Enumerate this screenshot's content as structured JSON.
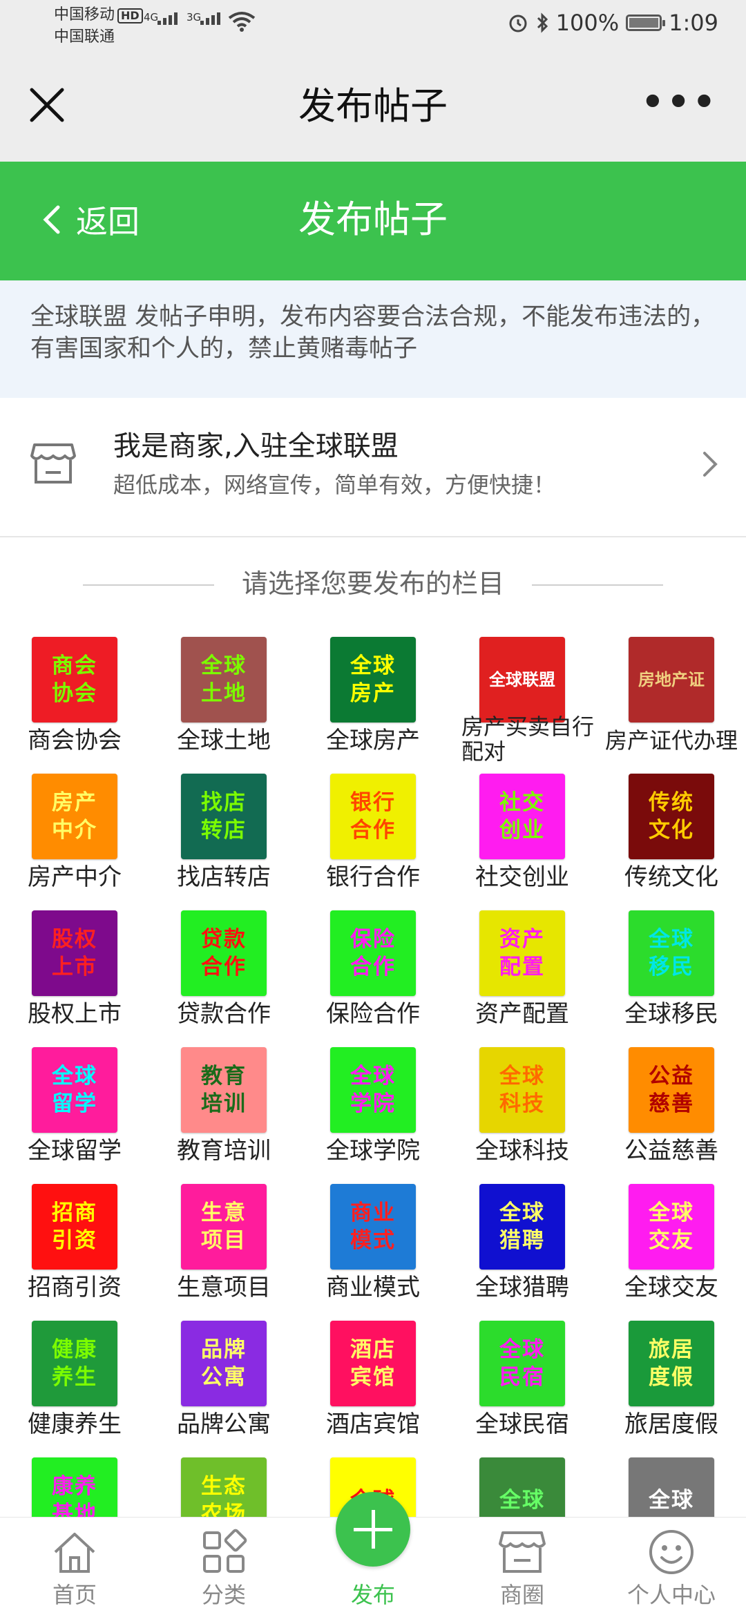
{
  "status_bar": {
    "carrier1": "中国移动",
    "hd": "HD",
    "carrier2": "中国联通",
    "net1": "4G",
    "net2": "3G",
    "battery": "100%",
    "time": "1:09"
  },
  "wx_bar": {
    "title": "发布帖子"
  },
  "header": {
    "back_label": "返回",
    "title": "发布帖子",
    "accent": "#3cc24e"
  },
  "notice": {
    "text": "全球联盟 发帖子申明，发布内容要合法合规，不能发布违法的，有害国家和个人的，禁止黄赌毒帖子"
  },
  "merchant": {
    "title": "我是商家,入驻全球联盟",
    "subtitle": "超低成本，网络宣传，简单有效，方便快捷！"
  },
  "section": {
    "title": "请选择您要发布的栏目"
  },
  "categories": [
    {
      "label": "商会协会",
      "tile1": "商会",
      "tile2": "协会",
      "bg": "#ee1c25",
      "fg": "#7cfc00"
    },
    {
      "label": "全球土地",
      "tile1": "全球",
      "tile2": "土地",
      "bg": "#a0524e",
      "fg": "#7cfc00"
    },
    {
      "label": "全球房产",
      "tile1": "全球",
      "tile2": "房产",
      "bg": "#0b7a33",
      "fg": "#ffff00"
    },
    {
      "label": "房产买卖自行配对",
      "tile1": "全球联盟",
      "tile2": "",
      "bg": "#e02020",
      "fg": "#ffffff"
    },
    {
      "label": "房产证代办理",
      "tile1": "房地产证",
      "tile2": "",
      "bg": "#b02a2a",
      "fg": "#f0d080"
    },
    {
      "label": "房产中介",
      "tile1": "房产",
      "tile2": "中介",
      "bg": "#ff8c00",
      "fg": "#ffff66"
    },
    {
      "label": "找店转店",
      "tile1": "找店",
      "tile2": "转店",
      "bg": "#126b52",
      "fg": "#7cfc00"
    },
    {
      "label": "银行合作",
      "tile1": "银行",
      "tile2": "合作",
      "bg": "#f0f000",
      "fg": "#ff4500"
    },
    {
      "label": "社交创业",
      "tile1": "社交",
      "tile2": "创业",
      "bg": "#ff1cf0",
      "fg": "#7cfc00"
    },
    {
      "label": "传统文化",
      "tile1": "传统",
      "tile2": "文化",
      "bg": "#7a0b0b",
      "fg": "#ffcc00"
    },
    {
      "label": "股权上市",
      "tile1": "股权",
      "tile2": "上市",
      "bg": "#7e0a8c",
      "fg": "#ff2020"
    },
    {
      "label": "贷款合作",
      "tile1": "贷款",
      "tile2": "合作",
      "bg": "#22ee22",
      "fg": "#ff1010"
    },
    {
      "label": "保险合作",
      "tile1": "保险",
      "tile2": "合作",
      "bg": "#22ee22",
      "fg": "#ff1cf0"
    },
    {
      "label": "资产配置",
      "tile1": "资产",
      "tile2": "配置",
      "bg": "#e6e600",
      "fg": "#ff1cf0"
    },
    {
      "label": "全球移民",
      "tile1": "全球",
      "tile2": "移民",
      "bg": "#2cdc2c",
      "fg": "#00e6e6"
    },
    {
      "label": "全球留学",
      "tile1": "全球",
      "tile2": "留学",
      "bg": "#ff1c9c",
      "fg": "#00ffff"
    },
    {
      "label": "教育培训",
      "tile1": "教育",
      "tile2": "培训",
      "bg": "#ff8a8a",
      "fg": "#1a6b1a"
    },
    {
      "label": "全球学院",
      "tile1": "全球",
      "tile2": "学院",
      "bg": "#22ee22",
      "fg": "#ff1cf0"
    },
    {
      "label": "全球科技",
      "tile1": "全球",
      "tile2": "科技",
      "bg": "#e6d600",
      "fg": "#ff6a00"
    },
    {
      "label": "公益慈善",
      "tile1": "公益",
      "tile2": "慈善",
      "bg": "#ff8c00",
      "fg": "#b00000"
    },
    {
      "label": "招商引资",
      "tile1": "招商",
      "tile2": "引资",
      "bg": "#ff1010",
      "fg": "#ffff00"
    },
    {
      "label": "生意项目",
      "tile1": "生意",
      "tile2": "项目",
      "bg": "#ff1c9c",
      "fg": "#ffff66"
    },
    {
      "label": "商业模式",
      "tile1": "商业",
      "tile2": "模式",
      "bg": "#1e7bd6",
      "fg": "#ff2020"
    },
    {
      "label": "全球猎聘",
      "tile1": "全球",
      "tile2": "猎聘",
      "bg": "#1010d0",
      "fg": "#ffff66"
    },
    {
      "label": "全球交友",
      "tile1": "全球",
      "tile2": "交友",
      "bg": "#ff1cf0",
      "fg": "#ffff66"
    },
    {
      "label": "健康养生",
      "tile1": "健康",
      "tile2": "养生",
      "bg": "#1f9a3a",
      "fg": "#7cfc00"
    },
    {
      "label": "品牌公寓",
      "tile1": "品牌",
      "tile2": "公寓",
      "bg": "#8a2be2",
      "fg": "#ffff66"
    },
    {
      "label": "酒店宾馆",
      "tile1": "酒店",
      "tile2": "宾馆",
      "bg": "#ff1060",
      "fg": "#ffff66"
    },
    {
      "label": "全球民宿",
      "tile1": "全球",
      "tile2": "民宿",
      "bg": "#2cdc2c",
      "fg": "#ff1cf0"
    },
    {
      "label": "旅居度假",
      "tile1": "旅居",
      "tile2": "度假",
      "bg": "#1a9a3a",
      "fg": "#ffff66"
    },
    {
      "label": "",
      "tile1": "康养",
      "tile2": "基地",
      "bg": "#22ee22",
      "fg": "#ff1cf0"
    },
    {
      "label": "",
      "tile1": "生态",
      "tile2": "农场",
      "bg": "#6fbf2a",
      "fg": "#ffff00"
    },
    {
      "label": "",
      "tile1": "全球",
      "tile2": "",
      "bg": "#ffff00",
      "fg": "#ff1010"
    },
    {
      "label": "",
      "tile1": "全球",
      "tile2": "",
      "bg": "#3a8a3a",
      "fg": "#66ff66"
    },
    {
      "label": "",
      "tile1": "全球",
      "tile2": "",
      "bg": "#777777",
      "fg": "#ffffff"
    }
  ],
  "tabs": [
    {
      "label": "首页",
      "icon": "home-icon"
    },
    {
      "label": "分类",
      "icon": "category-icon"
    },
    {
      "label": "发布",
      "icon": "plus-icon"
    },
    {
      "label": "商圈",
      "icon": "store-icon"
    },
    {
      "label": "个人中心",
      "icon": "smile-icon"
    }
  ]
}
